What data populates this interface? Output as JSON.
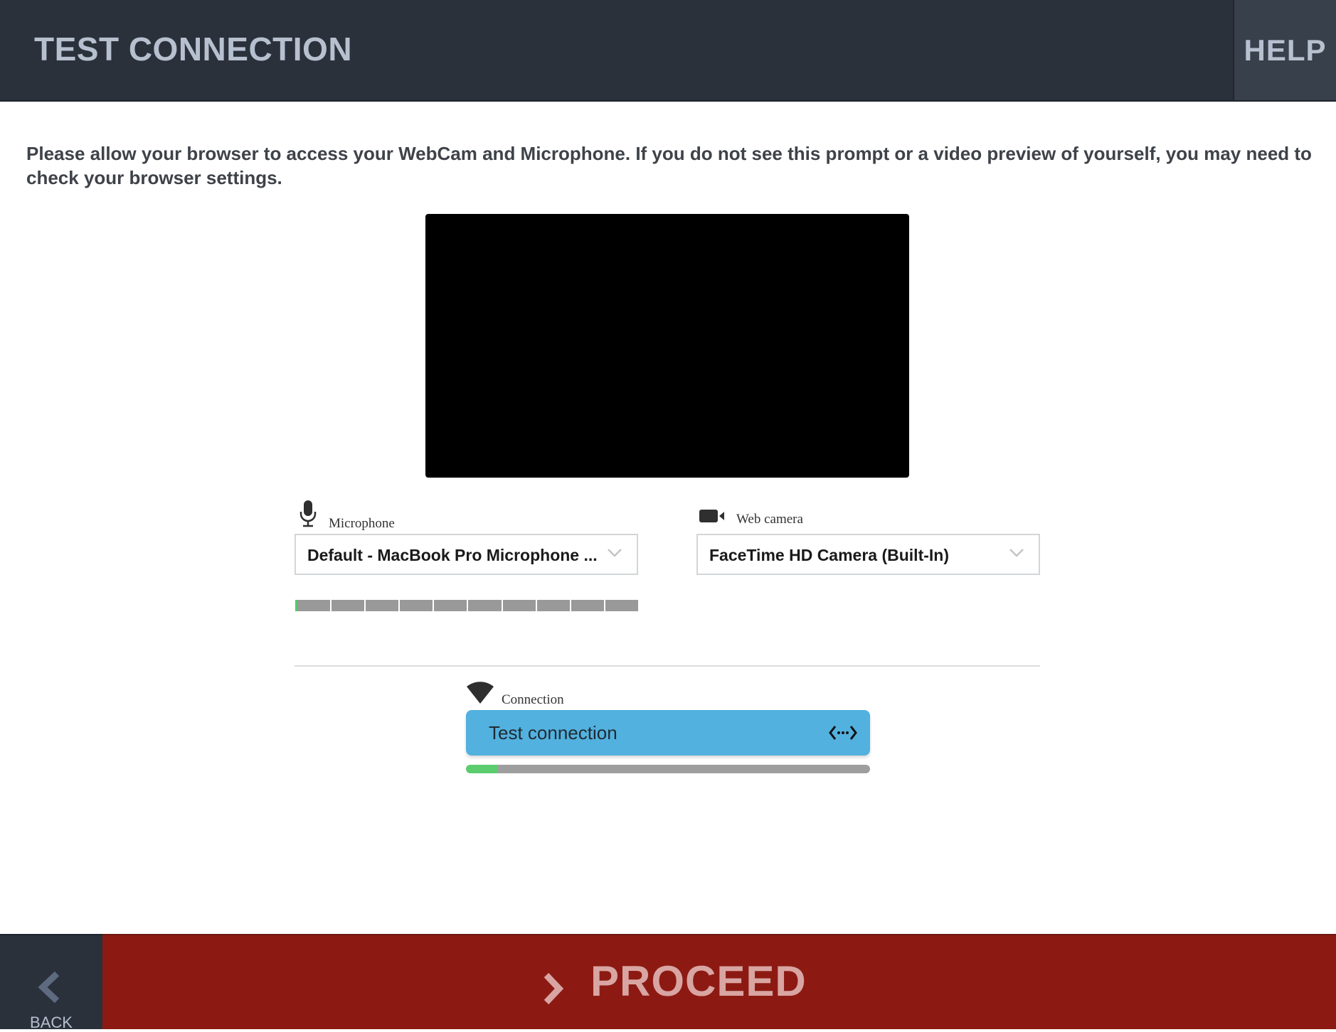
{
  "header": {
    "title": "TEST CONNECTION",
    "help_label": "HELP"
  },
  "instructions": "Please allow your browser to access your WebCam and Microphone. If you do not see this prompt or a video preview of yourself, you may need to check your browser settings.",
  "microphone": {
    "label": "Microphone",
    "selected": "Default - MacBook Pro Microphone ...",
    "icon": "microphone-icon",
    "level_segments": 10
  },
  "webcam": {
    "label": "Web camera",
    "selected": "FaceTime HD Camera (Built-In)",
    "icon": "video-camera-icon"
  },
  "connection": {
    "label": "Connection",
    "icon": "wifi-icon",
    "button_label": "Test connection",
    "button_icon": "code-arrows-icon",
    "progress_percent": 8
  },
  "footer": {
    "back_label": "BACK",
    "proceed_label": "PROCEED"
  },
  "colors": {
    "header_bg": "#2b313b",
    "accent_blue": "#52b1de",
    "proceed_red": "#8c1a13",
    "progress_green": "#5ccd6f"
  }
}
